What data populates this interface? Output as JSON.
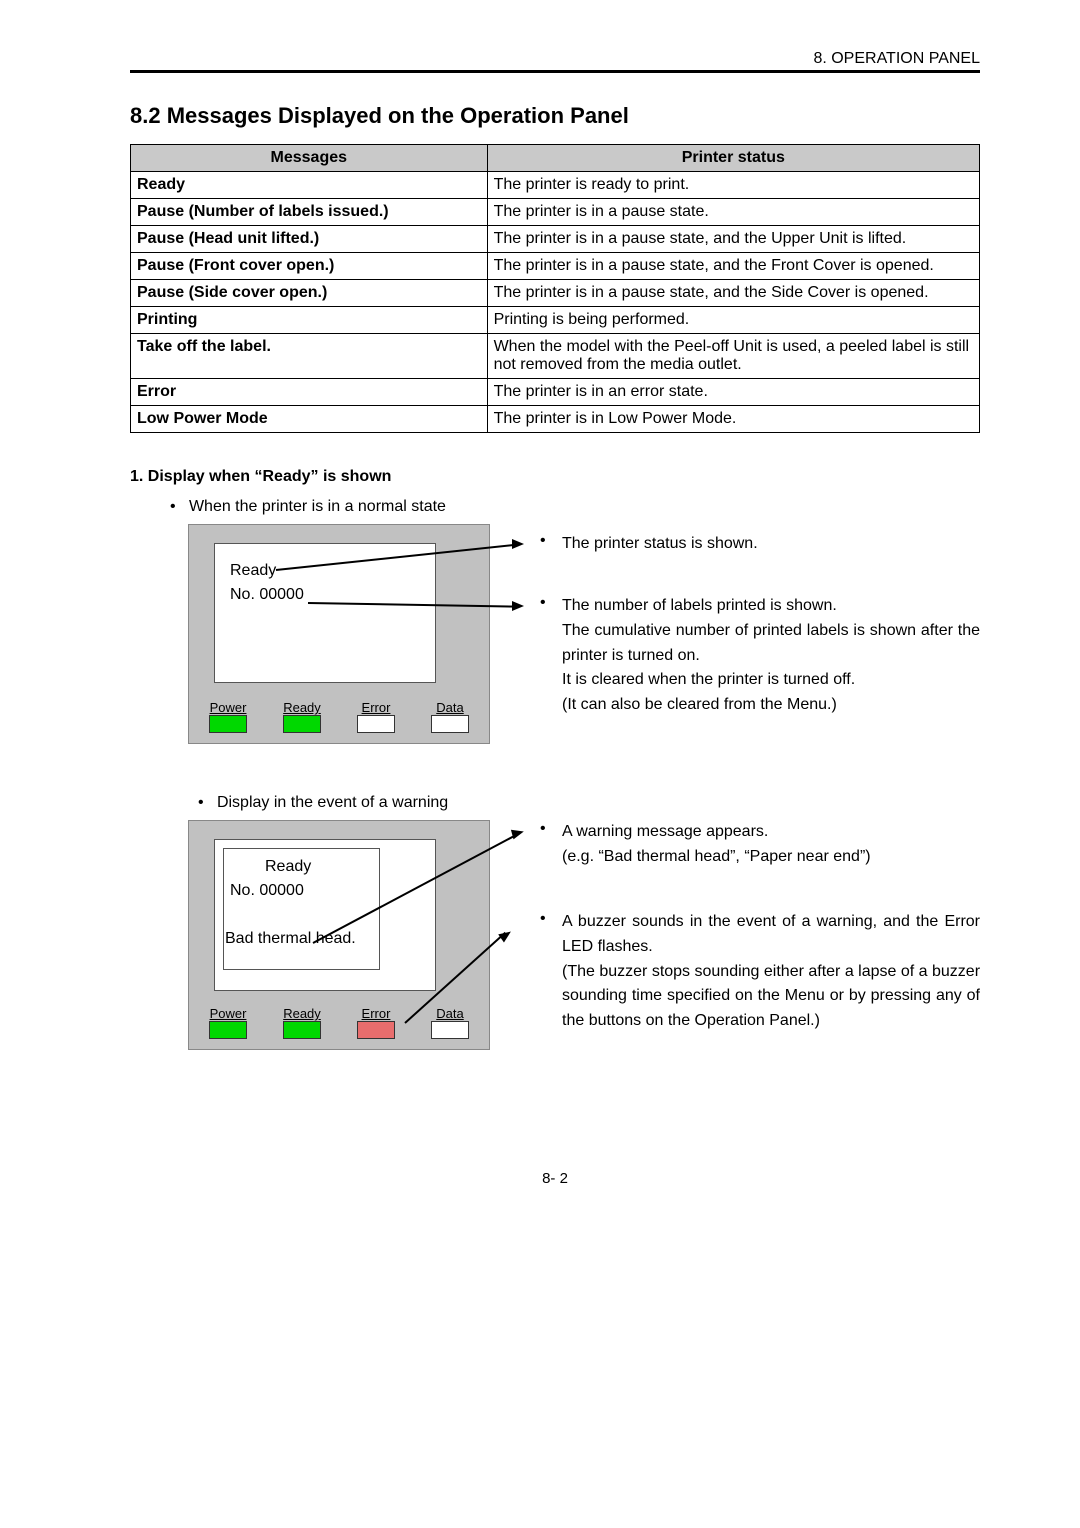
{
  "header": {
    "chapter": "8.  OPERATION PANEL"
  },
  "section": {
    "title": "8.2 Messages Displayed on the Operation Panel"
  },
  "table": {
    "headers": {
      "messages": "Messages",
      "status": "Printer status"
    },
    "rows": [
      {
        "msg": "Ready",
        "st": "The printer is ready to print."
      },
      {
        "msg": "Pause (Number of labels issued.)",
        "st": "The printer is in a pause state."
      },
      {
        "msg": "Pause (Head unit lifted.)",
        "st": "The printer is in a pause state, and the Upper Unit is lifted."
      },
      {
        "msg": "Pause (Front cover open.)",
        "st": "The printer is in a pause state, and the Front Cover is opened."
      },
      {
        "msg": "Pause (Side cover open.)",
        "st": "The printer is in a pause state, and the Side Cover is opened."
      },
      {
        "msg": "Printing",
        "st": "Printing is being performed."
      },
      {
        "msg": "Take off the label.",
        "st": "When the model with the Peel-off Unit is used, a peeled label is still not removed from the media outlet."
      },
      {
        "msg": "Error",
        "st": "The printer is in an error state."
      },
      {
        "msg": "Low Power Mode",
        "st": "The printer is in Low Power Mode."
      }
    ]
  },
  "sub1": {
    "heading": "1.    Display when “Ready” is shown",
    "bullet_normal": "When the printer is in a normal state",
    "bullet_warning": "Display in the event of a warning"
  },
  "panel1": {
    "line1": "Ready",
    "line2": "No. 00000"
  },
  "panel2": {
    "line1": "Ready",
    "line2": "No. 00000",
    "line3": "Bad thermal head."
  },
  "leds": {
    "power": "Power",
    "ready": "Ready",
    "error": "Error",
    "data": "Data"
  },
  "explain1": {
    "e1": "The printer status is shown.",
    "e2a": "The number of labels printed is shown.",
    "e2b": "The cumulative number of printed labels is shown after the printer is turned on.",
    "e2c": "It is cleared when the printer is turned off.",
    "e2d": "(It can also be cleared from the Menu.)"
  },
  "explain2": {
    "e1": "A warning message appears.",
    "e1b": "(e.g. “Bad thermal head”, “Paper near end”)",
    "e2a": "A buzzer sounds in the event of a warning, and the Error LED flashes.",
    "e2b": "(The buzzer stops sounding either after a lapse of a buzzer sounding time specified on the Menu or by pressing any of the buttons on the Operation Panel.)"
  },
  "pagenum": "8- 2"
}
